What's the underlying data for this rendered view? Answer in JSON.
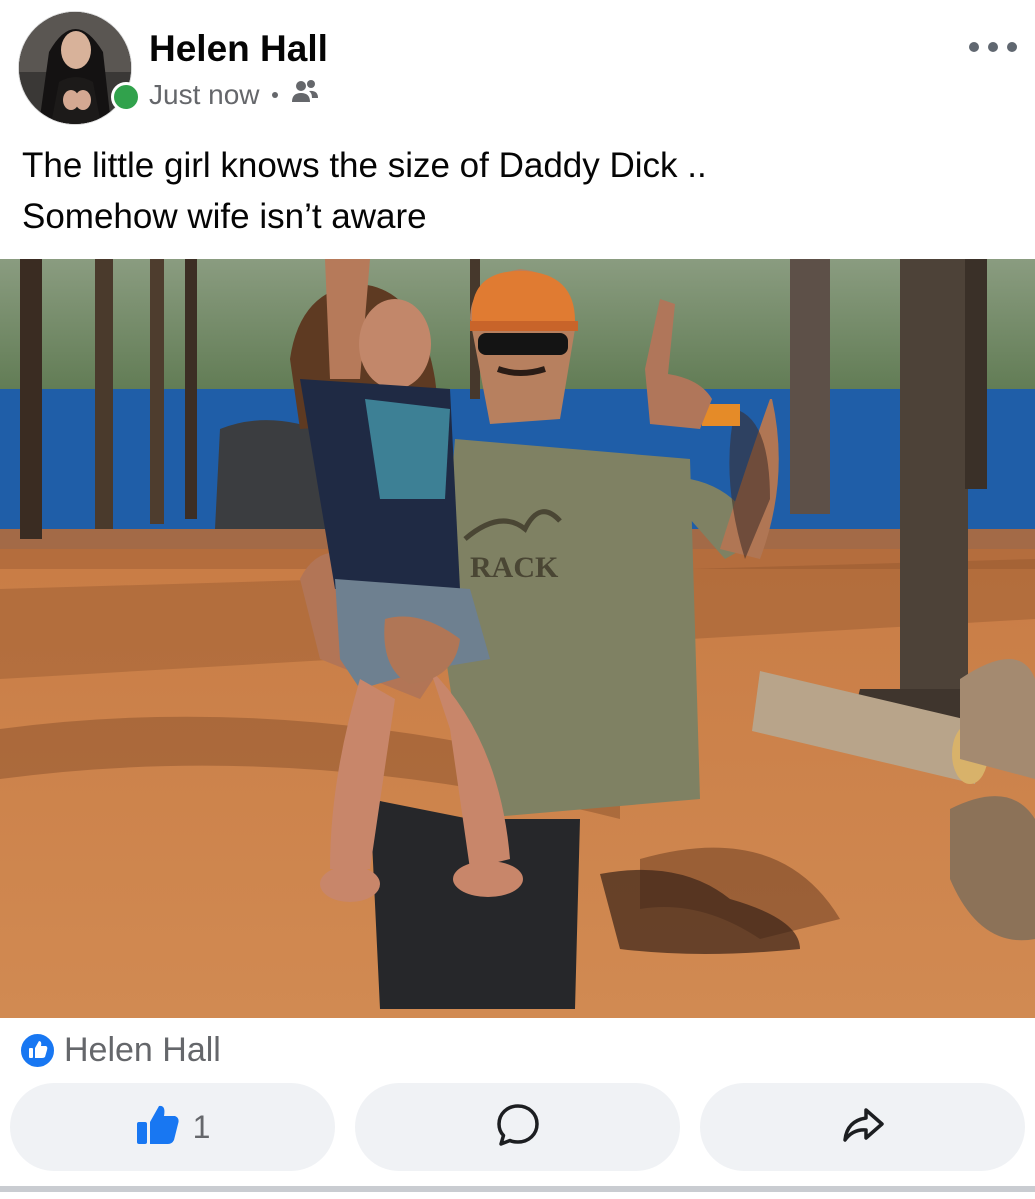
{
  "post": {
    "author": "Helen Hall",
    "timestamp": "Just now",
    "audience_icon": "friends-icon",
    "more_icon": "more-horizontal-icon",
    "text_lines": [
      "The little girl knows the size of Daddy Dick ..",
      "Somehow wife isn’t aware"
    ],
    "online_status_color": "#31a24c"
  },
  "reactions": {
    "icon": "like-reaction-icon",
    "reactor": "Helen Hall",
    "accent_color": "#1877f2"
  },
  "actions": {
    "like": {
      "icon": "thumbs-up-icon",
      "count": "1"
    },
    "comment": {
      "icon": "comment-bubble-icon"
    },
    "share": {
      "icon": "share-arrow-icon"
    }
  },
  "photo": {
    "shirt_text": "RACK"
  }
}
